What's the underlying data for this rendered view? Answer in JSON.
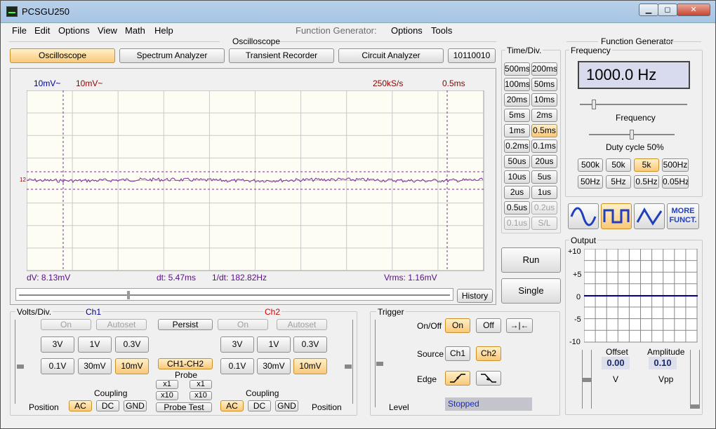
{
  "window": {
    "title": "PCSGU250",
    "min": "▁",
    "max": "◻",
    "close": "✕"
  },
  "menu": [
    "File",
    "Edit",
    "Options",
    "View",
    "Math",
    "Help"
  ],
  "fg_menu": {
    "label": "Function Generator:",
    "options": "Options",
    "tools": "Tools"
  },
  "osc": {
    "section": "Oscilloscope",
    "tabs": [
      "Oscilloscope",
      "Spectrum Analyzer",
      "Transient Recorder",
      "Circuit Analyzer",
      "10110010"
    ]
  },
  "scope": {
    "ch1_scale": "10mV~",
    "ch2_scale": "10mV~",
    "rate": "250kS/s",
    "timebase": "0.5ms",
    "marker": "12",
    "dv": "dV: 8.13mV",
    "dt": "dt: 5.47ms",
    "inv_dt": "1/dt: 182.82Hz",
    "vrms": "Vrms: 1.16mV",
    "history": "History"
  },
  "timediv": {
    "title": "Time/Div.",
    "buttons": [
      [
        "500ms",
        "200ms"
      ],
      [
        "100ms",
        "50ms"
      ],
      [
        "20ms",
        "10ms"
      ],
      [
        "5ms",
        "2ms"
      ],
      [
        "1ms",
        "0.5ms"
      ],
      [
        "0.2ms",
        "0.1ms"
      ],
      [
        "50us",
        "20us"
      ],
      [
        "10us",
        "5us"
      ],
      [
        "2us",
        "1us"
      ],
      [
        "0.5us",
        "0.2us"
      ],
      [
        "0.1us",
        "S/L"
      ]
    ]
  },
  "run": "Run",
  "single": "Single",
  "volts": {
    "title": "Volts/Div.",
    "ch1": "Ch1",
    "ch2": "Ch2",
    "on": "On",
    "autoset": "Autoset",
    "persist": "Persist",
    "v3": "3V",
    "v1": "1V",
    "v03": "0.3V",
    "v01": "0.1V",
    "v30m": "30mV",
    "v10m": "10mV",
    "ch1ch2": "CH1-CH2",
    "probe": "Probe",
    "x1": "x1",
    "x10": "x10",
    "probe_test": "Probe Test",
    "coupling": "Coupling",
    "ac": "AC",
    "dc": "DC",
    "gnd": "GND",
    "position": "Position"
  },
  "trigger": {
    "title": "Trigger",
    "onoff": "On/Off",
    "on": "On",
    "off": "Off",
    "source": "Source",
    "ch1": "Ch1",
    "ch2": "Ch2",
    "edge": "Edge",
    "level": "Level",
    "status": "Stopped"
  },
  "fg": {
    "title": "Function Generator",
    "frequency": "Frequency",
    "freq_value": "1000.0 Hz",
    "freq_label": "Frequency",
    "duty": "Duty cycle 50%",
    "range": [
      "500k",
      "50k",
      "5k",
      "500Hz",
      "50Hz",
      "5Hz",
      "0.5Hz",
      "0.05Hz"
    ],
    "more": "MORE FUNCT.",
    "output": "Output",
    "yticks": [
      "+10",
      "+5",
      "0",
      "-5",
      "-10"
    ],
    "offset": "Offset",
    "offset_value": "0.00",
    "offset_unit": "V",
    "amplitude": "Amplitude",
    "amplitude_value": "0.10",
    "amplitude_unit": "Vpp"
  },
  "colors": {
    "ch1": "#00008b",
    "ch2": "#8b0000",
    "trace": "#7a2a9a",
    "active": "#f9c87a",
    "fgtrace": "#00008b"
  }
}
